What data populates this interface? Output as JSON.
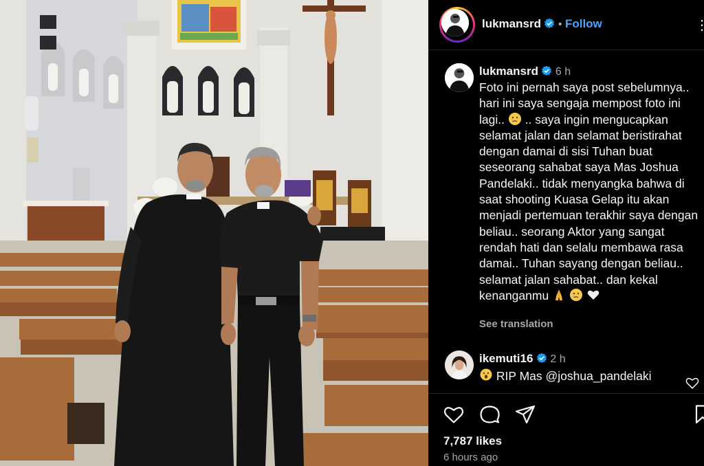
{
  "photo": {
    "alt_subject": "",
    "colors": {
      "wall": "#e4e2dd",
      "pew": "#a86b3a",
      "cassock": "#141414",
      "window_glass": "#e9c44a"
    }
  },
  "header": {
    "username": "lukmansrd",
    "separator": "•",
    "follow_label": "Follow",
    "more_label": "⋮"
  },
  "caption": {
    "username": "lukmansrd",
    "time": "6 h",
    "text_before_emoji": "Foto ini pernah saya post sebelumnya.. hari ini saya sengaja mempost foto ini lagi.. ",
    "text_after_emoji": " .. saya ingin mengucapkan selamat jalan dan selamat beristirahat dengan damai di sisi Tuhan buat seseorang sahabat saya Mas Joshua Pandelaki.. tidak menyangka bahwa di saat shooting Kuasa Gelap itu akan menjadi pertemuan terakhir saya dengan beliau.. seorang Aktor yang sangat rendah hati dan selalu membawa rasa damai.. Tuhan sayang dengan beliau.. selamat jalan sahabat.. dan kekal kenanganmu ",
    "see_translation": "See translation"
  },
  "comment": {
    "username": "ikemuti16",
    "time": "2 h",
    "text": "RIP Mas @joshua_pandelaki"
  },
  "actions": {
    "likes": "7,787 likes",
    "time_ago": "6 hours ago"
  },
  "icons": {
    "verified": "verified-badge-icon",
    "like": "heart-icon",
    "comment": "comment-bubble-icon",
    "share": "paper-plane-icon",
    "save": "bookmark-icon",
    "more": "more-options-icon"
  },
  "colors": {
    "accent": "#4aa3ff",
    "verified_blue": "#1d9bf0",
    "muted_text": "#a8a8a8",
    "background": "#000000"
  }
}
